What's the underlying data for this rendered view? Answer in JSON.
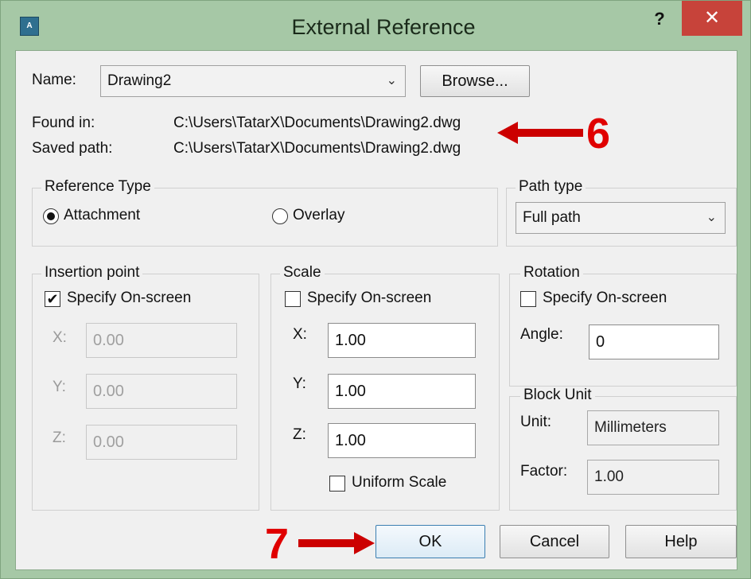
{
  "window": {
    "title": "External Reference",
    "help_label": "?",
    "close_label": "✕",
    "app_icon": "xref-app-icon"
  },
  "name_row": {
    "label": "Name:",
    "value": "Drawing2",
    "browse_label": "Browse..."
  },
  "paths": {
    "found_label": "Found in:",
    "found_value": "C:\\Users\\TatarX\\Documents\\Drawing2.dwg",
    "saved_label": "Saved path:",
    "saved_value": "C:\\Users\\TatarX\\Documents\\Drawing2.dwg"
  },
  "reference_type": {
    "title": "Reference Type",
    "attachment": "Attachment",
    "overlay": "Overlay",
    "selected": "Attachment"
  },
  "path_type": {
    "title": "Path type",
    "value": "Full path"
  },
  "insertion_point": {
    "title": "Insertion point",
    "specify_label": "Specify On-screen",
    "checked": true,
    "x_label": "X:",
    "x_value": "0.00",
    "y_label": "Y:",
    "y_value": "0.00",
    "z_label": "Z:",
    "z_value": "0.00"
  },
  "scale": {
    "title": "Scale",
    "specify_label": "Specify On-screen",
    "checked": false,
    "x_label": "X:",
    "x_value": "1.00",
    "y_label": "Y:",
    "y_value": "1.00",
    "z_label": "Z:",
    "z_value": "1.00",
    "uniform_label": "Uniform Scale"
  },
  "rotation": {
    "title": "Rotation",
    "specify_label": "Specify On-screen",
    "checked": false,
    "angle_label": "Angle:",
    "angle_value": "0"
  },
  "block_unit": {
    "title": "Block Unit",
    "unit_label": "Unit:",
    "unit_value": "Millimeters",
    "factor_label": "Factor:",
    "factor_value": "1.00"
  },
  "buttons": {
    "ok": "OK",
    "cancel": "Cancel",
    "help": "Help"
  },
  "annotations": {
    "step6": "6",
    "step7": "7",
    "arrow_color": "#cc0000"
  }
}
